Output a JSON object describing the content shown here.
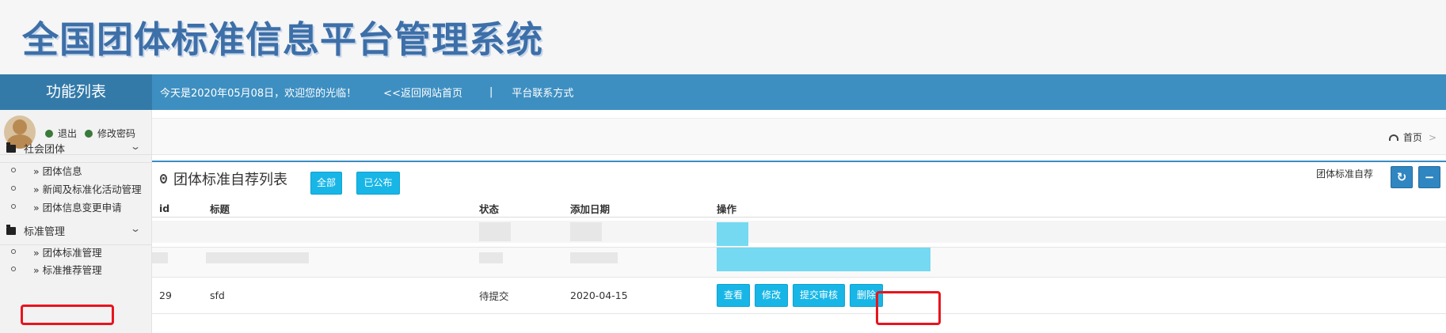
{
  "banner": {
    "title": "全国团体标准信息平台管理系统"
  },
  "navbar": {
    "menu_title": "功能列表",
    "welcome": "今天是2020年05月08日，欢迎您的光临！",
    "back_link": "<<返回网站首页",
    "separator": "|",
    "contact_link": "平台联系方式"
  },
  "user": {
    "logout": "退出",
    "change_password": "修改密码"
  },
  "sidebar": {
    "groups": [
      {
        "label": "社会团体",
        "items": [
          "» 团体信息",
          "» 新闻及标准化活动管理",
          "» 团体信息变更申请"
        ]
      },
      {
        "label": "标准管理",
        "items": [
          "» 团体标准管理",
          "» 标准推荐管理"
        ]
      }
    ],
    "chevron": "⌄"
  },
  "breadcrumb": {
    "home": "首页",
    "arrow": ">"
  },
  "panel": {
    "title": "团体标准自荐列表",
    "filter_all": "全部",
    "filter_published": "已公布",
    "right_label": "团体标准自荐",
    "refresh_icon": "↻",
    "collapse_icon": "−"
  },
  "table": {
    "headers": [
      "id",
      "标题",
      "状态",
      "添加日期",
      "操作"
    ],
    "rows": [
      {
        "id": "29",
        "title": "sfd",
        "status": "待提交",
        "date": "2020-04-15",
        "ops": [
          "查看",
          "修改",
          "提交审核",
          "删除"
        ]
      }
    ]
  },
  "colors": {
    "accent": "#3e8fc1",
    "button": "#18b6e6",
    "highlight": "#e8141e"
  }
}
